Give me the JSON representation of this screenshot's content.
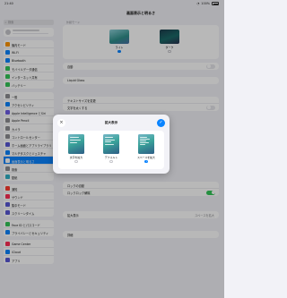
{
  "status_bar": {
    "time": "21:40",
    "date": "4月22日(火)",
    "wifi": "100%"
  },
  "sidebar": {
    "title": "設定",
    "search_placeholder": "検索",
    "group1": [
      {
        "label": "機内モード",
        "color": "#ff9500"
      },
      {
        "label": "Wi-Fi",
        "color": "#0a84ff"
      },
      {
        "label": "Bluetooth",
        "color": "#0a84ff"
      },
      {
        "label": "モバイルデータ通信",
        "color": "#34c759"
      },
      {
        "label": "インターネット共有",
        "color": "#34c759"
      },
      {
        "label": "バッテリー",
        "color": "#34c759"
      }
    ],
    "group2": [
      {
        "label": "一般",
        "color": "#8e8e93"
      },
      {
        "label": "アクセシビリティ",
        "color": "#0a84ff"
      },
      {
        "label": "Apple Intelligence とSiri",
        "color": "#6e5de8"
      },
      {
        "label": "Apple Pencil",
        "color": "#8e8e93"
      },
      {
        "label": "カメラ",
        "color": "#8e8e93"
      },
      {
        "label": "コントロールセンター",
        "color": "#8e8e93"
      },
      {
        "label": "ホーム画面とアプリライブラリ",
        "color": "#5856d6"
      },
      {
        "label": "マルチタスクとジェスチャ",
        "color": "#0a84ff"
      },
      {
        "label": "画面表示と明るさ",
        "color": "#0a84ff"
      },
      {
        "label": "検索",
        "color": "#8e8e93"
      },
      {
        "label": "壁紙",
        "color": "#30b0c7"
      }
    ],
    "group3": [
      {
        "label": "通知",
        "color": "#ff3b30"
      },
      {
        "label": "サウンド",
        "color": "#ff2d55"
      },
      {
        "label": "集中モード",
        "color": "#5856d6"
      },
      {
        "label": "スクリーンタイム",
        "color": "#5856d6"
      }
    ],
    "group4": [
      {
        "label": "Face ID とパスコード",
        "color": "#34c759"
      },
      {
        "label": "プライバシーとセキュリティ",
        "color": "#0a84ff"
      }
    ],
    "group5": [
      {
        "label": "Game Center",
        "color": "#ff2d55"
      },
      {
        "label": "iCloud",
        "color": "#0a84ff"
      },
      {
        "label": "アプリ",
        "color": "#5856d6"
      }
    ]
  },
  "main": {
    "title": "画面表示と明るさ",
    "appearance_header": "外観モード",
    "appearance_options": [
      {
        "label": "ライト",
        "selected": true
      },
      {
        "label": "ダーク",
        "selected": false
      }
    ],
    "auto_label": "自動",
    "liquid_glass_label": "Liquid Glass",
    "text_size_label": "テキストサイズを変更",
    "bold_text_label": "文字を太くする",
    "auto_lock_label": "ロックの自動",
    "rotation_lock_label": "ロックロック解除",
    "display_zoom_label": "拡大表示",
    "display_zoom_value": "スペースを拡大",
    "reference_mode_label": "詳細"
  },
  "modal": {
    "title": "拡大表示",
    "close_icon": "×",
    "done_icon": "✓",
    "options": [
      {
        "label": "文字を拡大",
        "selected": false
      },
      {
        "label": "デフォルト",
        "selected": false
      },
      {
        "label": "スペースを拡大",
        "selected": true
      }
    ]
  }
}
